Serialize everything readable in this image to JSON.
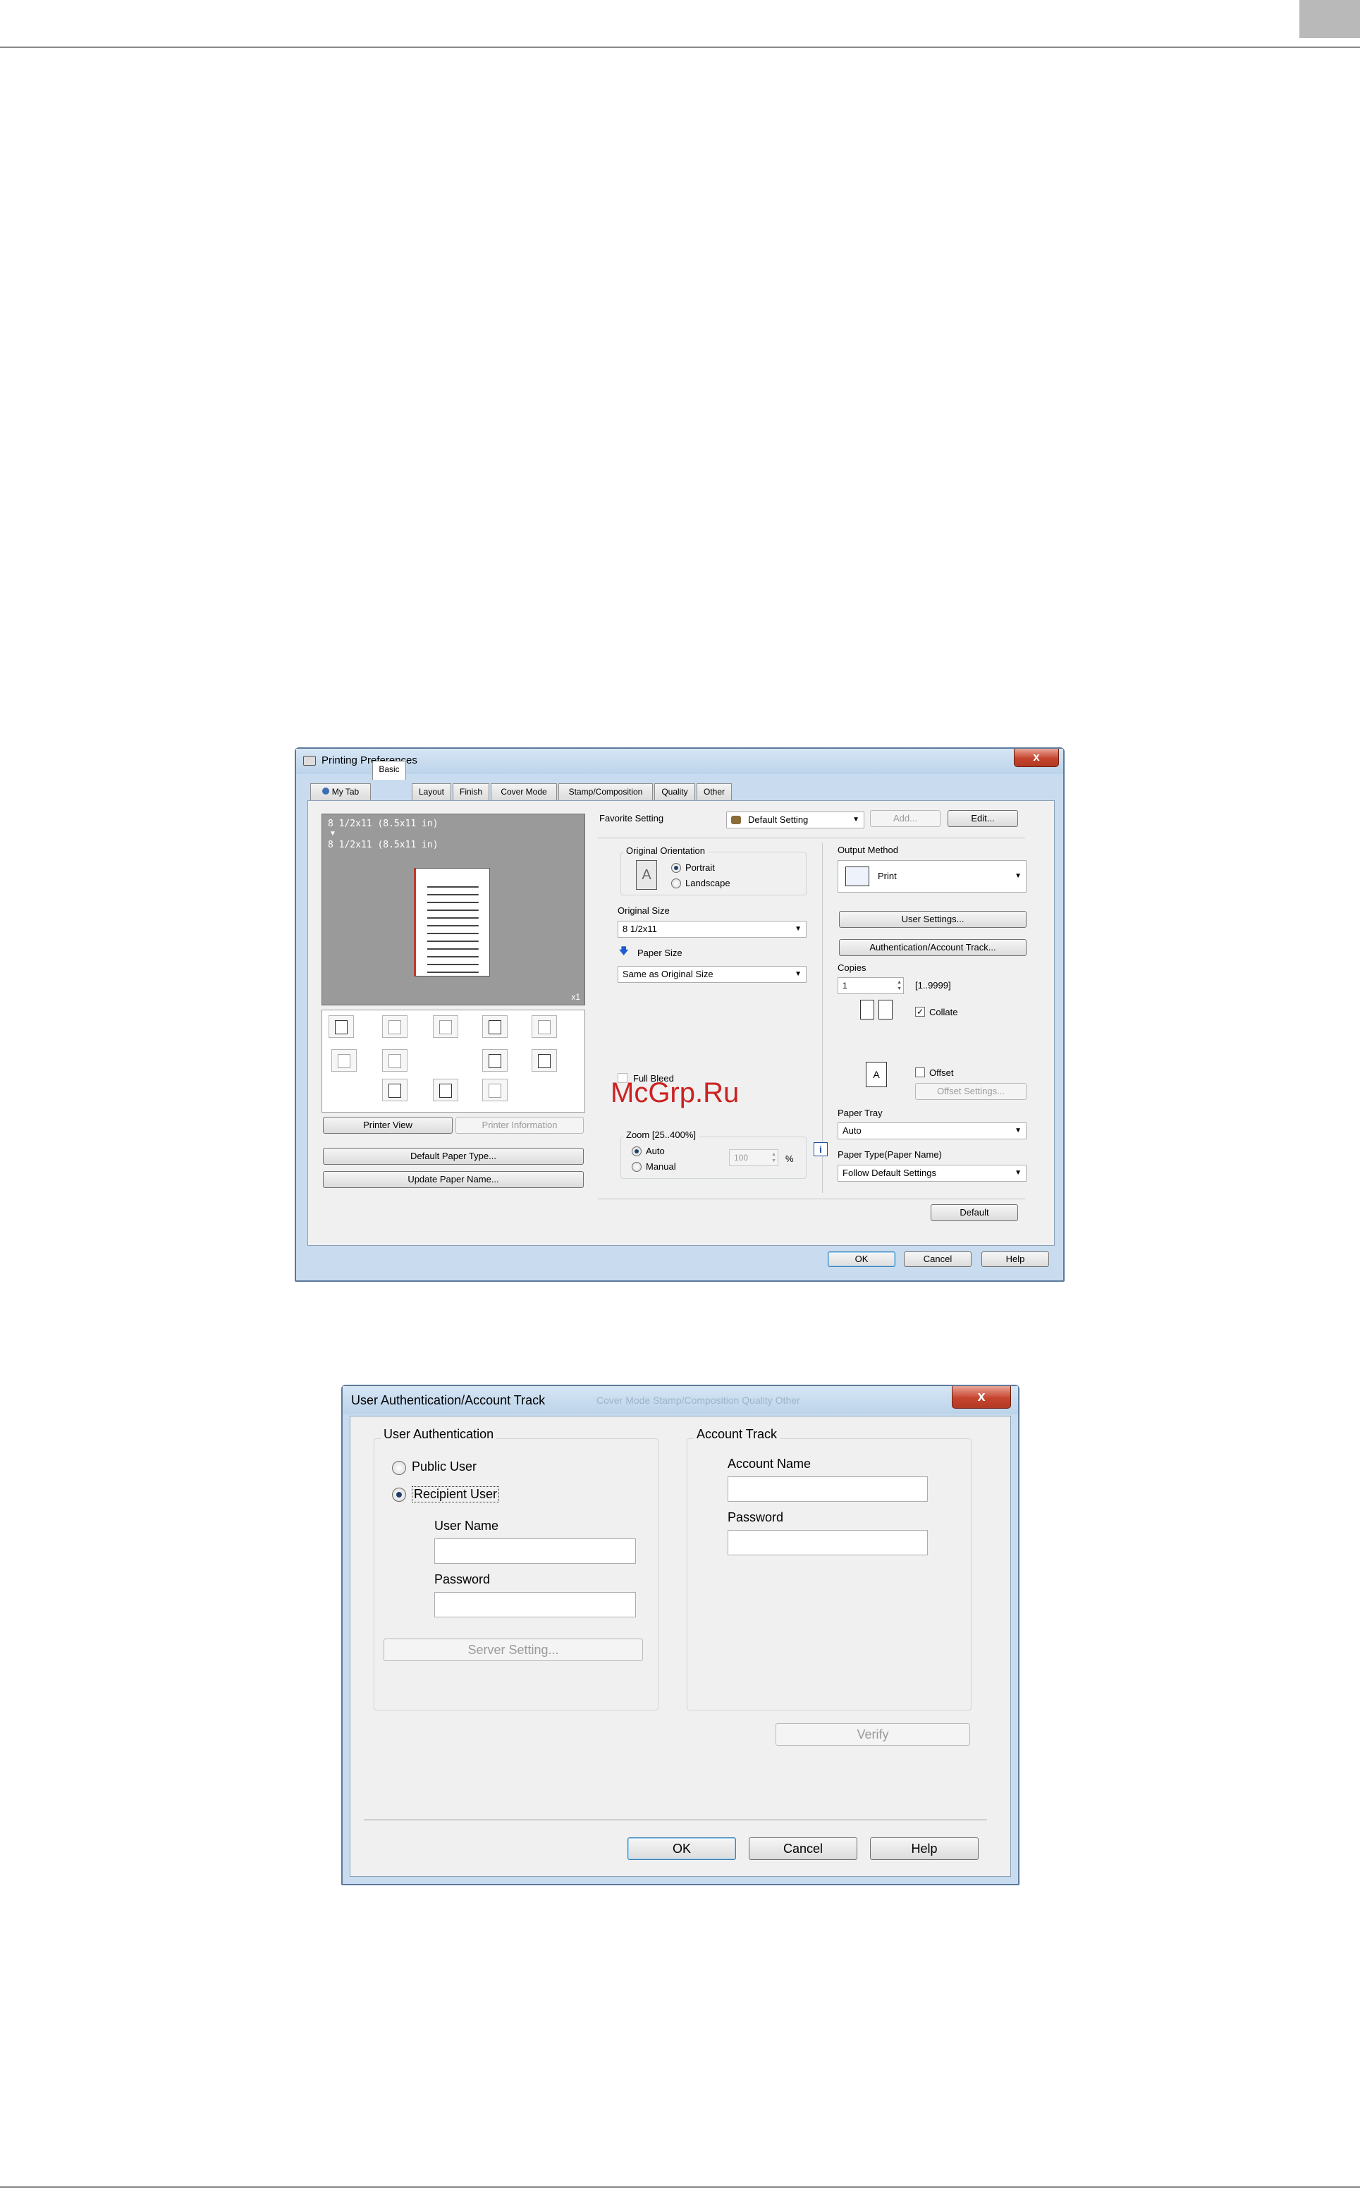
{
  "print_prefs": {
    "title": "Printing Preferences",
    "close": "x",
    "tabs": [
      "My Tab",
      "Basic",
      "Layout",
      "Finish",
      "Cover Mode",
      "Stamp/Composition",
      "Quality",
      "Other"
    ],
    "preview_line1": "8 1/2x11 (8.5x11 in)",
    "preview_arrow": "▼",
    "preview_line2": "8 1/2x11 (8.5x11 in)",
    "preview_count": "x1",
    "printer_view": "Printer View",
    "printer_information": "Printer Information",
    "default_paper_type": "Default Paper Type...",
    "update_paper_name": "Update Paper Name...",
    "favorite_label": "Favorite Setting",
    "favorite_value": "Default Setting",
    "add_btn": "Add...",
    "edit_btn": "Edit...",
    "orientation_title": "Original Orientation",
    "portrait": "Portrait",
    "landscape": "Landscape",
    "original_size_label": "Original Size",
    "original_size_value": "8 1/2x11",
    "paper_size_label": "Paper Size",
    "paper_size_value": "Same as Original Size",
    "full_bleed": "Full Bleed",
    "watermark": "McGrp.Ru",
    "zoom_title": "Zoom [25..400%]",
    "zoom_auto": "Auto",
    "zoom_manual": "Manual",
    "zoom_value": "100",
    "zoom_unit": "%",
    "output_method_label": "Output Method",
    "output_method_value": "Print",
    "user_settings": "User Settings...",
    "auth_account": "Authentication/Account Track...",
    "copies_label": "Copies",
    "copies_value": "1",
    "copies_range": "[1..9999]",
    "collate": "Collate",
    "offset": "Offset",
    "offset_settings": "Offset Settings...",
    "paper_tray_label": "Paper Tray",
    "paper_tray_value": "Auto",
    "paper_type_label": "Paper Type(Paper Name)",
    "paper_type_value": "Follow Default Settings",
    "default_btn": "Default",
    "ok": "OK",
    "cancel": "Cancel",
    "help": "Help",
    "accent": "#c6442d"
  },
  "auth_dialog": {
    "title": "User Authentication/Account Track",
    "ghost_tabs": "Cover Mode   Stamp/Composition   Quality   Other",
    "close": "x",
    "user_auth_title": "User Authentication",
    "public_user": "Public User",
    "recipient_user": "Recipient User",
    "user_name_label": "User Name",
    "password_label": "Password",
    "server_setting": "Server Setting...",
    "account_track_title": "Account Track",
    "account_name_label": "Account Name",
    "account_password_label": "Password",
    "verify": "Verify",
    "ok": "OK",
    "cancel": "Cancel",
    "help": "Help"
  }
}
